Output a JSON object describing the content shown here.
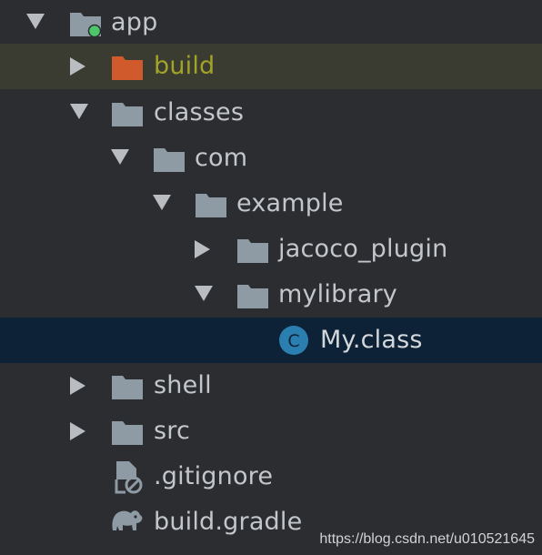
{
  "colors": {
    "background": "#2b2d30",
    "text": "#c3c6ca",
    "excluded_text": "#a3a328",
    "excluded_row": "#3a3b31",
    "selected_row": "#0d2236",
    "folder": "#8f9ba4",
    "excluded_folder": "#d05a2b",
    "class_badge": "#2b7fb0",
    "module_dot": "#4cc66b"
  },
  "tree": {
    "items": [
      {
        "label": "app",
        "icon": "module-folder-icon",
        "expanded": true
      },
      {
        "label": "build",
        "icon": "excluded-folder-icon",
        "expanded": false
      },
      {
        "label": "classes",
        "icon": "folder-icon",
        "expanded": true
      },
      {
        "label": "com",
        "icon": "folder-icon",
        "expanded": true
      },
      {
        "label": "example",
        "icon": "folder-icon",
        "expanded": true
      },
      {
        "label": "jacoco_plugin",
        "icon": "folder-icon",
        "expanded": false
      },
      {
        "label": "mylibrary",
        "icon": "folder-icon",
        "expanded": true
      },
      {
        "label": "My.class",
        "icon": "class-file-icon",
        "badge": "C",
        "selected": true
      },
      {
        "label": "shell",
        "icon": "folder-icon",
        "expanded": false
      },
      {
        "label": "src",
        "icon": "folder-icon",
        "expanded": false
      },
      {
        "label": ".gitignore",
        "icon": "ignored-file-icon"
      },
      {
        "label": "build.gradle",
        "icon": "gradle-elephant-icon"
      }
    ]
  },
  "watermark": "https://blog.csdn.net/u010521645"
}
